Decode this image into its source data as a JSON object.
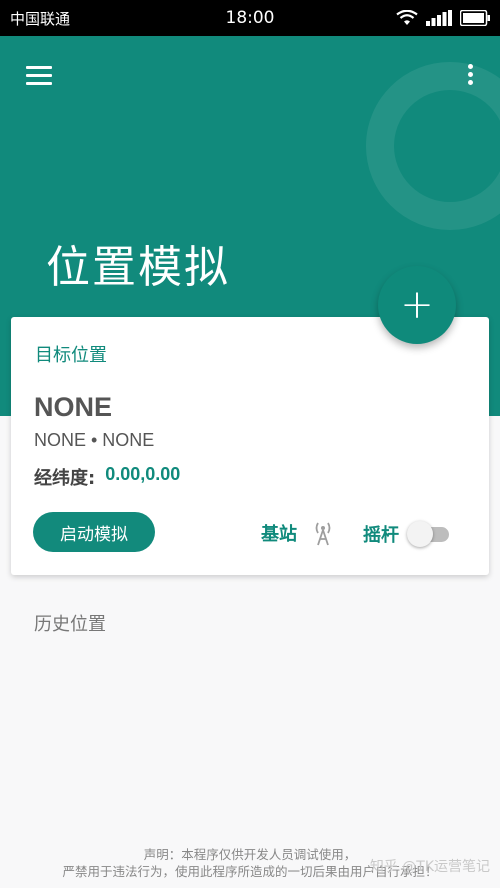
{
  "status_bar": {
    "carrier": "中国联通",
    "time": "18:00"
  },
  "header": {
    "title": "位置模拟"
  },
  "fab": {
    "label": "+"
  },
  "card": {
    "title": "目标位置",
    "location_name": "NONE",
    "location_detail": "NONE • NONE",
    "coord_label": "经纬度:",
    "coord_value": "0.00,0.00",
    "start_button": "启动模拟",
    "station_label": "基站",
    "joystick_label": "摇杆",
    "joystick_on": false
  },
  "history": {
    "title": "历史位置"
  },
  "footer": {
    "line1": "声明：本程序仅供开发人员调试使用，",
    "line2": "严禁用于违法行为，使用此程序所造成的一切后果由用户自行承担！"
  },
  "watermark": "知乎 @TK运营笔记",
  "colors": {
    "primary": "#118a7c",
    "accent_text": "#108a7c"
  }
}
